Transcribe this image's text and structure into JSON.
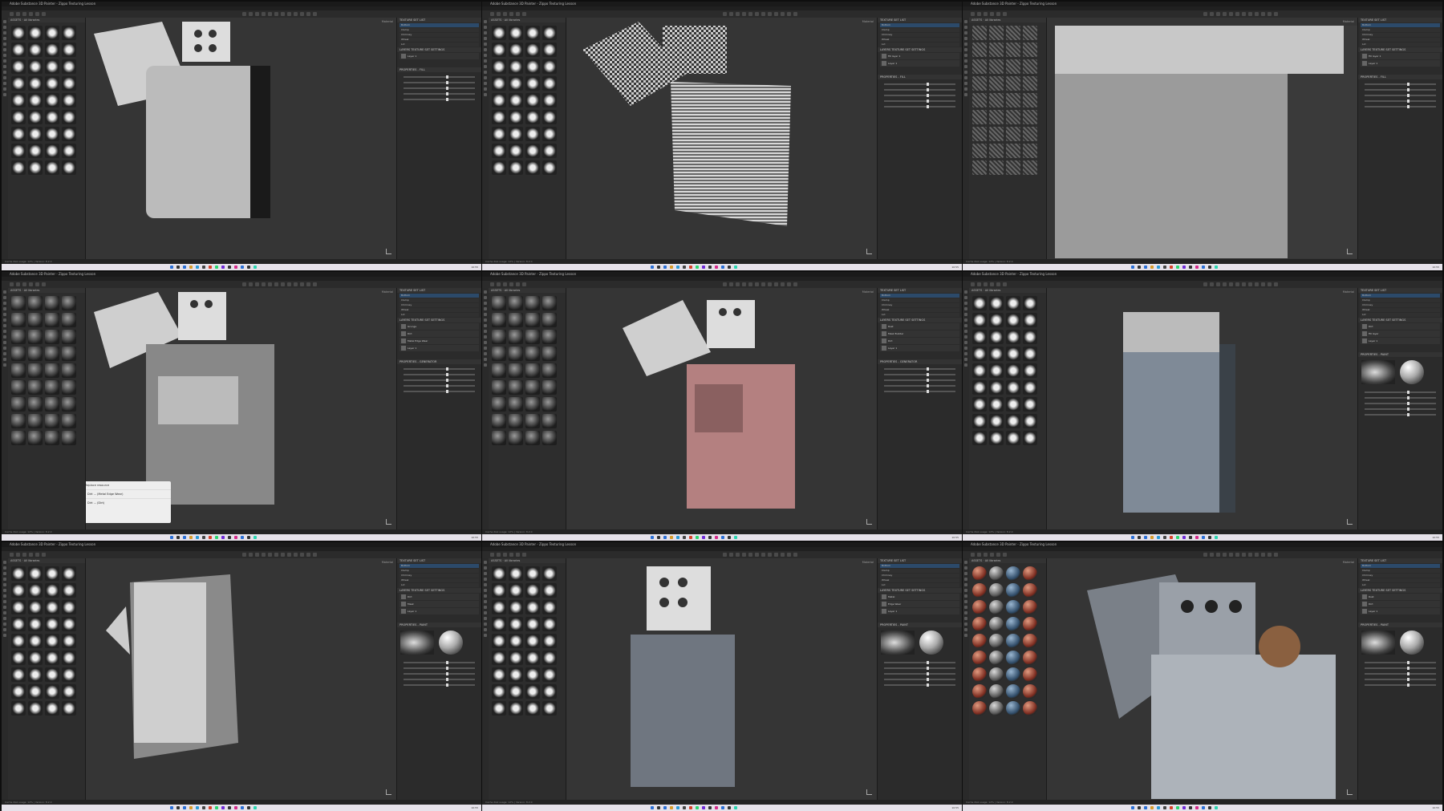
{
  "app": {
    "window_title": "Adobe Substance 3D Painter - Zippo Texturing Lesson",
    "menu": [
      "File",
      "Edit",
      "Mode",
      "Window",
      "Viewport",
      "Plugins",
      "Help"
    ],
    "statusbar": "Cache disk usage: 12% | Version: 8.2.0",
    "clock": "10:55"
  },
  "panels": {
    "assets": "ASSETS",
    "texture_set_list": "TEXTURE SET LIST",
    "layers": "LAYERS",
    "texture_set_settings": "TEXTURE SET SETTINGS",
    "properties_fill": "PROPERTIES - FILL",
    "properties_generator": "PROPERTIES - GENERATOR",
    "properties_paint": "PROPERTIES - PAINT"
  },
  "viewport_mode": "Material",
  "texture_sets": [
    "Bottom",
    "Clamp",
    "Chimney",
    "Wheel",
    "Lid"
  ],
  "cells": [
    {
      "assets_header": "All libraries",
      "properties": "PROPERTIES - FILL",
      "layers": [
        "Layer 1"
      ],
      "thumb_style": "white",
      "object": "lighter-clean"
    },
    {
      "assets_header": "All libraries",
      "properties": "PROPERTIES - FILL",
      "layers": [
        "Fill layer 1",
        "Layer 1"
      ],
      "thumb_style": "white",
      "object": "lighter-checker"
    },
    {
      "assets_header": "All libraries",
      "properties": "PROPERTIES - FILL",
      "layers": [
        "Fill layer 1",
        "Layer 1"
      ],
      "thumb_style": "tex",
      "object": "closeup-scratched"
    },
    {
      "assets_header": "All libraries",
      "properties": "PROPERTIES - GENERATOR",
      "layers": [
        "Grunge",
        "Dirt",
        "Metal Edge Wear",
        "Layer 1"
      ],
      "thumb_style": "gray",
      "object": "lighter-grunge",
      "popup": {
        "title": "Replace resource",
        "options": [
          "Dirt ... (Metal Edge Wear)",
          "Dirt ... (Dirt)"
        ]
      }
    },
    {
      "assets_header": "All libraries",
      "properties": "PROPERTIES - GENERATOR",
      "layers": [
        "Rust",
        "Mask Builder",
        "Dirt",
        "Layer 1"
      ],
      "thumb_style": "gray",
      "object": "lighter-rust"
    },
    {
      "assets_header": "All libraries",
      "properties": "PROPERTIES - PAINT",
      "layers": [
        "Dirt",
        "Fill layer",
        "Layer 1"
      ],
      "thumb_style": "white",
      "object": "lighter-worn"
    },
    {
      "assets_header": "All libraries",
      "properties": "PROPERTIES - PAINT",
      "layers": [
        "Dirt",
        "Mask",
        "Layer 1"
      ],
      "thumb_style": "white",
      "object": "lighter-metal"
    },
    {
      "assets_header": "All libraries",
      "properties": "PROPERTIES - PAINT",
      "layers": [
        "Metal",
        "Edge Wear",
        "Layer 1"
      ],
      "thumb_style": "white",
      "object": "lighter-final-a"
    },
    {
      "assets_header": "All libraries",
      "properties": "PROPERTIES - PAINT",
      "layers": [
        "Rust",
        "Dirt",
        "Layer 1"
      ],
      "thumb_style": "balls",
      "object": "lighter-final-b"
    }
  ]
}
